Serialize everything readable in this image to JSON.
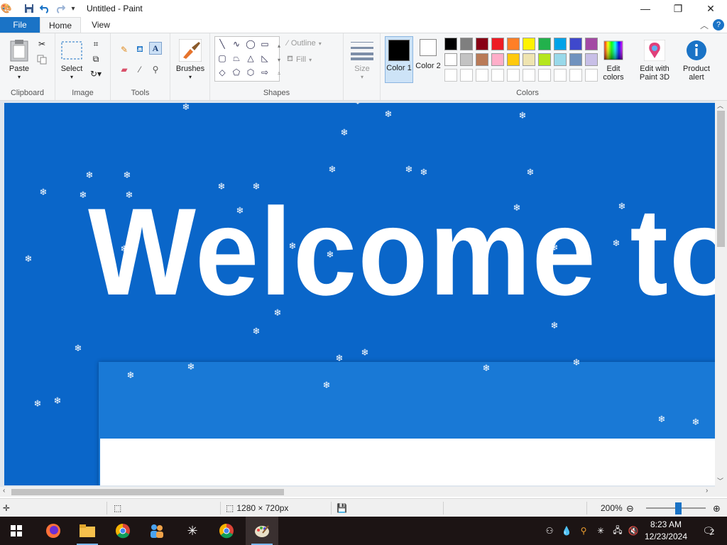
{
  "window": {
    "title": "Untitled - Paint"
  },
  "quick_access": {
    "icons": [
      "paint-app-icon",
      "save-icon",
      "undo-icon",
      "redo-icon",
      "customize-dropdown-icon"
    ]
  },
  "tabs": {
    "file": "File",
    "home": "Home",
    "view": "View"
  },
  "ribbon": {
    "clipboard": {
      "group": "Clipboard",
      "paste": "Paste"
    },
    "image": {
      "group": "Image",
      "select": "Select"
    },
    "tools": {
      "group": "Tools"
    },
    "brushes": {
      "label": "Brushes"
    },
    "shapes": {
      "group": "Shapes",
      "outline": "Outline",
      "fill": "Fill"
    },
    "size": {
      "label": "Size"
    },
    "colors": {
      "group": "Colors",
      "color1": "Color 1",
      "color2": "Color 2",
      "edit_colors": "Edit colors",
      "edit_3d": "Edit with Paint 3D",
      "product_alert": "Product alert",
      "color1_value": "#000000",
      "color2_value": "#ffffff",
      "palette_row1": [
        "#000000",
        "#7f7f7f",
        "#880015",
        "#ed1c24",
        "#ff7f27",
        "#fff200",
        "#22b14c",
        "#00a2e8",
        "#3f48cc",
        "#a349a4"
      ],
      "palette_row2": [
        "#ffffff",
        "#c3c3c3",
        "#b97a57",
        "#ffaec9",
        "#ffc90e",
        "#efe4b0",
        "#b5e61d",
        "#99d9ea",
        "#7092be",
        "#c8bfe7"
      ]
    }
  },
  "canvas": {
    "heading": "Welcome to"
  },
  "status": {
    "dimensions": "1280 × 720px",
    "zoom": "200%"
  },
  "taskbar": {
    "apps": [
      "start-icon",
      "firefox-icon",
      "file-explorer-icon",
      "chrome-icon",
      "people-icon",
      "snowflake-app-icon",
      "chrome-icon-2",
      "paint-icon"
    ],
    "time": "8:23 AM",
    "date": "12/23/2024",
    "notifications": "2"
  }
}
